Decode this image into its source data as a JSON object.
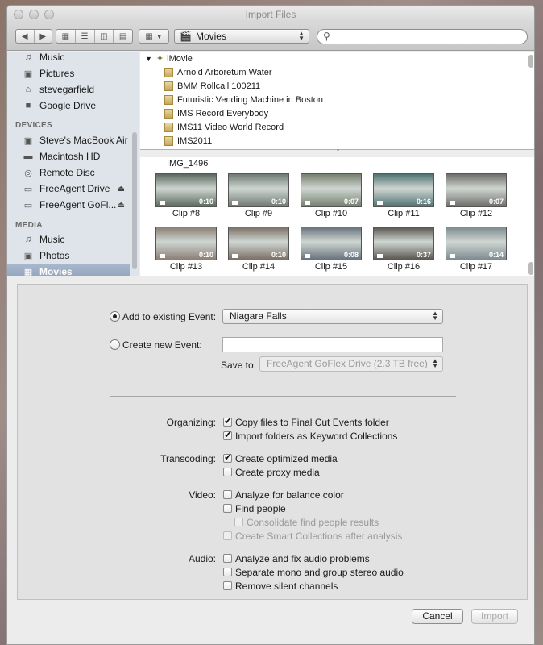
{
  "window": {
    "title": "Import Files"
  },
  "toolbar": {
    "location": "Movies"
  },
  "sidebar": {
    "items_top": [
      {
        "label": "Music",
        "icon": "music-icon"
      },
      {
        "label": "Pictures",
        "icon": "camera-icon"
      },
      {
        "label": "stevegarfield",
        "icon": "home-icon"
      },
      {
        "label": "Google Drive",
        "icon": "folder-icon"
      }
    ],
    "devices_header": "DEVICES",
    "devices": [
      {
        "label": "Steve's MacBook Air"
      },
      {
        "label": "Macintosh HD"
      },
      {
        "label": "Remote Disc"
      },
      {
        "label": "FreeAgent Drive"
      },
      {
        "label": "FreeAgent GoFl..."
      }
    ],
    "media_header": "MEDIA",
    "media": [
      {
        "label": "Music"
      },
      {
        "label": "Photos"
      },
      {
        "label": "Movies"
      }
    ]
  },
  "browser": {
    "root": "iMovie",
    "folders": [
      "Arnold Arboretum Water",
      "BMM Rollcall 100211",
      "Futuristic Vending Machine in Boston",
      "IMS Record Everybody",
      "IMS11 Video World Record",
      "IMS2011"
    ]
  },
  "clips": {
    "folder_label": "IMG_1496",
    "items": [
      {
        "label": "Clip #8",
        "duration": "0:10",
        "tone": "#5b6a5e"
      },
      {
        "label": "Clip #9",
        "duration": "0:10",
        "tone": "#6e7a72"
      },
      {
        "label": "Clip #10",
        "duration": "0:07",
        "tone": "#75806f"
      },
      {
        "label": "Clip #11",
        "duration": "0:16",
        "tone": "#4f7373"
      },
      {
        "label": "Clip #12",
        "duration": "0:07",
        "tone": "#6f6d69"
      },
      {
        "label": "Clip #13",
        "duration": "0:10",
        "tone": "#8a7f74"
      },
      {
        "label": "Clip #14",
        "duration": "0:10",
        "tone": "#7b6f66"
      },
      {
        "label": "Clip #15",
        "duration": "0:08",
        "tone": "#67737d"
      },
      {
        "label": "Clip #16",
        "duration": "0:37",
        "tone": "#5a5550"
      },
      {
        "label": "Clip #17",
        "duration": "0:14",
        "tone": "#7d8b90"
      }
    ]
  },
  "import": {
    "add_existing_label": "Add to existing Event:",
    "existing_event": "Niagara Falls",
    "create_new_label": "Create new Event:",
    "new_event_value": "",
    "save_to_label": "Save to:",
    "save_to_value": "FreeAgent GoFlex Drive   (2.3 TB free)",
    "organizing_label": "Organizing:",
    "copy_files": "Copy files to Final Cut Events folder",
    "import_folders": "Import folders as Keyword Collections",
    "transcoding_label": "Transcoding:",
    "create_optimized": "Create optimized media",
    "create_proxy": "Create proxy media",
    "video_label": "Video:",
    "analyze_balance": "Analyze for balance color",
    "find_people": "Find people",
    "consolidate_people": "Consolidate find people results",
    "smart_collections": "Create Smart Collections after analysis",
    "audio_label": "Audio:",
    "analyze_audio": "Analyze and fix audio problems",
    "separate_mono": "Separate mono and group stereo audio",
    "remove_silent": "Remove silent channels"
  },
  "buttons": {
    "cancel": "Cancel",
    "import": "Import"
  }
}
